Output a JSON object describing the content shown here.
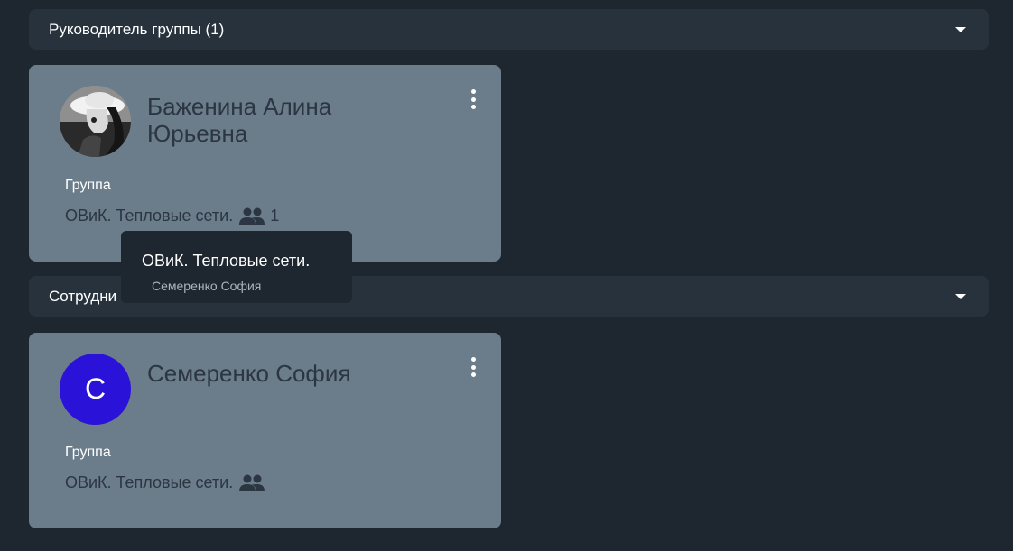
{
  "sections": {
    "leader": {
      "title": "Руководитель группы (1)"
    },
    "employees": {
      "title": "Сотрудни"
    }
  },
  "leader_card": {
    "name": "Баженина Алина Юрьевна",
    "group_label": "Группа",
    "group_name": "ОВиК. Тепловые сети.",
    "member_count": "1",
    "avatar": "photo"
  },
  "employee_card": {
    "name": "Семеренко София",
    "avatar_letter": "С",
    "group_label": "Группа",
    "group_name": "ОВиК. Тепловые сети."
  },
  "tooltip": {
    "title": "ОВиК. Тепловые сети.",
    "members": [
      "Семеренко София"
    ]
  },
  "colors": {
    "background": "#1e2730",
    "header": "#28323d",
    "card": "#6b7c8b",
    "letter_avatar": "#2a12d8"
  },
  "icons": {
    "expand": "chevron-down-icon",
    "menu": "more-vert-icon",
    "group": "people-icon"
  }
}
